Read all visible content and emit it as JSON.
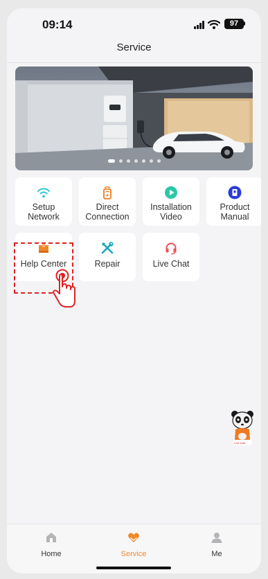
{
  "status_bar": {
    "time": "09:14",
    "battery": "97"
  },
  "header": {
    "title": "Service"
  },
  "banner": {
    "slide_count": 7,
    "active_slide": 1
  },
  "grid": {
    "setup_network": {
      "line1": "Setup",
      "line2": "Network",
      "icon": "wifi-icon",
      "color": "#2ec4d6"
    },
    "direct_connection": {
      "line1": "Direct",
      "line2": "Connection",
      "icon": "phone-signal-icon",
      "color": "#f07a22"
    },
    "installation_video": {
      "line1": "Installation",
      "line2": "Video",
      "icon": "play-icon",
      "color": "#2bc7a8"
    },
    "product_manual": {
      "line1": "Product",
      "line2": "Manual",
      "icon": "book-icon",
      "color": "#2a3cd8"
    },
    "help_center": {
      "label": "Help Center",
      "icon": "box-icon",
      "color": "#f0882a"
    },
    "repair": {
      "label": "Repair",
      "icon": "tools-icon",
      "color": "#1aa8b8"
    },
    "live_chat": {
      "label": "Live Chat",
      "icon": "headset-icon",
      "color": "#f0505a"
    }
  },
  "mascot": {
    "caption": "Live chat"
  },
  "tabbar": {
    "home": "Home",
    "service": "Service",
    "me": "Me",
    "active_color": "#f08a2a",
    "inactive_color": "#9a9a9e"
  }
}
